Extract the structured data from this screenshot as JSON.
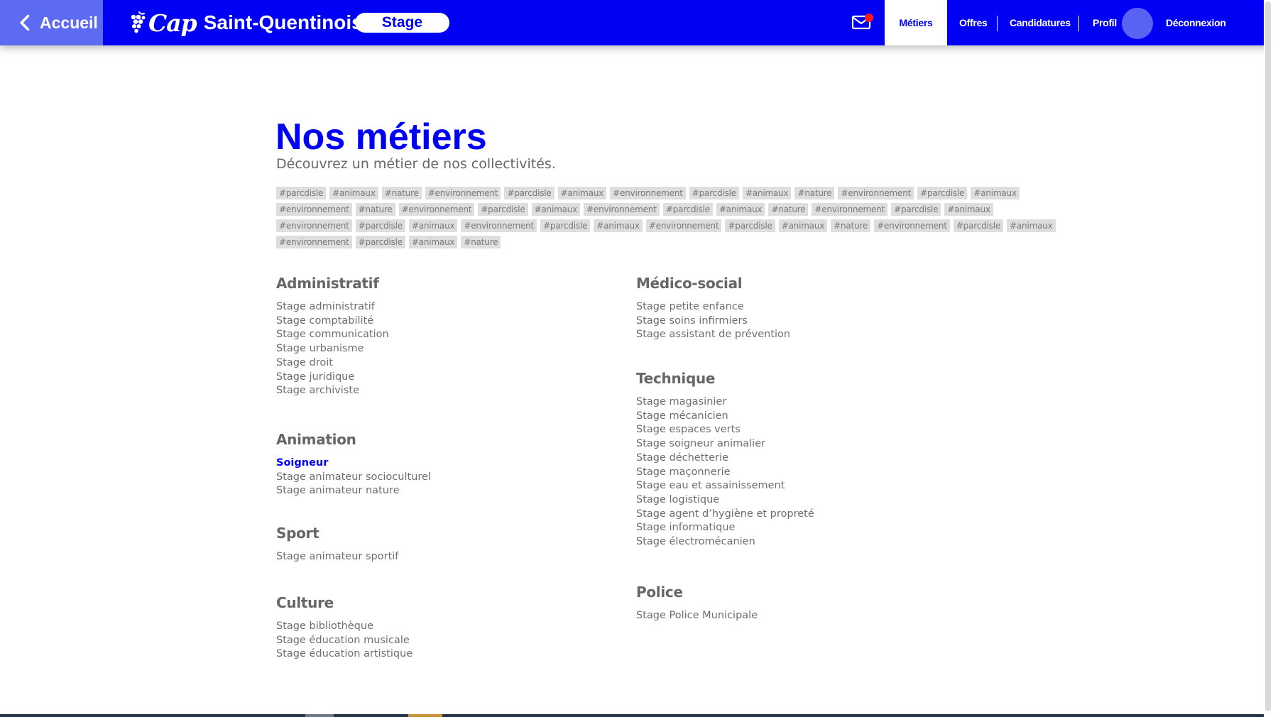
{
  "header": {
    "back_label": "Accueil",
    "logo_cap": "Cap",
    "logo_city": "Saint-Quentinois",
    "section_badge": "Stage",
    "nav": {
      "metiers": "Métiers",
      "offres": "Offres",
      "candidatures": "Candidatures",
      "profil": "Profil",
      "deconnexion": "Déconnexion"
    },
    "active_nav": "metiers",
    "has_unread_mail": true
  },
  "main": {
    "title": "Nos métiers",
    "subtitle": "Découvrez un métier de nos collectivités.",
    "tags": [
      "#parcdisle",
      "#animaux",
      "#nature",
      "#environnement",
      "#parcdisle",
      "#animaux",
      "#environnement",
      "#parcdisle",
      "#animaux",
      "#nature",
      "#environnement",
      "#parcdisle",
      "#animaux",
      "#environnement",
      "#nature",
      "#environnement",
      "#parcdisle",
      "#animaux",
      "#environnement",
      "#parcdisle",
      "#animaux",
      "#nature",
      "#environnement",
      "#parcdisle",
      "#animaux",
      "#environnement",
      "#parcdisle",
      "#animaux",
      "#environnement",
      "#parcdisle",
      "#animaux",
      "#environnement",
      "#parcdisle",
      "#animaux",
      "#nature",
      "#environnement",
      "#parcdisle",
      "#animaux",
      "#environnement",
      "#parcdisle",
      "#animaux",
      "#nature"
    ],
    "categories": {
      "administratif": {
        "title": "Administratif",
        "items": [
          "Stage administratif",
          "Stage comptabilité",
          "Stage communication",
          "Stage urbanisme",
          "Stage droit",
          "Stage juridique",
          "Stage archiviste"
        ]
      },
      "animation": {
        "title": "Animation",
        "items": [
          "Soigneur",
          "Stage animateur socioculturel",
          "Stage animateur nature"
        ],
        "active_item": "Soigneur"
      },
      "sport": {
        "title": "Sport",
        "items": [
          "Stage animateur sportif"
        ]
      },
      "culture": {
        "title": "Culture",
        "items": [
          "Stage bibliothèque",
          "Stage éducation musicale",
          "Stage éducation artistique"
        ]
      },
      "medico_social": {
        "title": "Médico-social",
        "items": [
          "Stage petite enfance",
          "Stage soins infirmiers",
          "Stage assistant de prévention"
        ]
      },
      "technique": {
        "title": "Technique",
        "items": [
          "Stage magasinier",
          "Stage mécanicien",
          "Stage espaces verts",
          "Stage soigneur animalier",
          "Stage déchetterie",
          "Stage maçonnerie",
          "Stage eau et assainissement",
          "Stage logistique",
          "Stage agent d’hygiène et propreté",
          "Stage informatique",
          "Stage électromécanien"
        ]
      },
      "police": {
        "title": "Police",
        "items": [
          "Stage Police Municipale"
        ]
      }
    }
  },
  "colors": {
    "brand_blue": "#0000f5",
    "back_button": "#5d6af2",
    "avatar": "#5a62f3",
    "notification_dot": "#ff1a1a",
    "tag_bg": "#dedede",
    "text_grey": "#6b6b6b"
  }
}
